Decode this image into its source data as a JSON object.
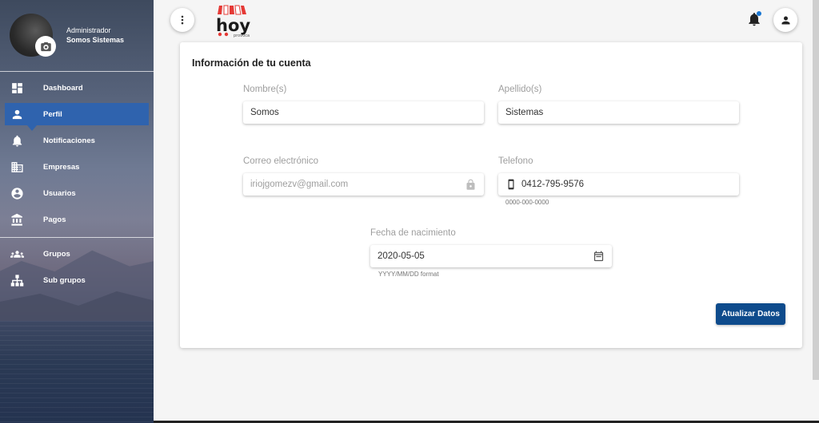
{
  "profile": {
    "role": "Administrador",
    "name": "Somos Sistemas"
  },
  "sidebar": {
    "items": [
      {
        "label": "Dashboard",
        "icon": "dashboard-icon"
      },
      {
        "label": "Perfil",
        "icon": "person-icon",
        "active": true
      },
      {
        "label": "Notificaciones",
        "icon": "bell-icon"
      },
      {
        "label": "Empresas",
        "icon": "building-icon"
      },
      {
        "label": "Usuarios",
        "icon": "account-circle-icon"
      },
      {
        "label": "Pagos",
        "icon": "bank-icon"
      },
      {
        "label": "Grupos",
        "icon": "group-icon"
      },
      {
        "label": "Sub grupos",
        "icon": "sitemap-icon"
      }
    ]
  },
  "header": {
    "logo_text": "hoy",
    "logo_sub": "provoca",
    "notification_dot_color": "#1976d2"
  },
  "form": {
    "title": "Información de tu cuenta",
    "first_name": {
      "label": "Nombre(s)",
      "value": "Somos"
    },
    "last_name": {
      "label": "Apellido(s)",
      "value": "Sistemas"
    },
    "email": {
      "label": "Correo electrónico",
      "value": "iriojgomezv@gmail.com",
      "locked": true
    },
    "phone": {
      "label": "Telefono",
      "value": "0412-795-9576",
      "hint": "0000-000-0000"
    },
    "birthdate": {
      "label": "Fecha de nacimiento",
      "value": "2020-05-05",
      "hint": "YYYY/MM/DD format"
    },
    "submit_label": "Atualizar Datos"
  },
  "colors": {
    "accent": "#2f63ae",
    "button": "#0e4b8c"
  }
}
